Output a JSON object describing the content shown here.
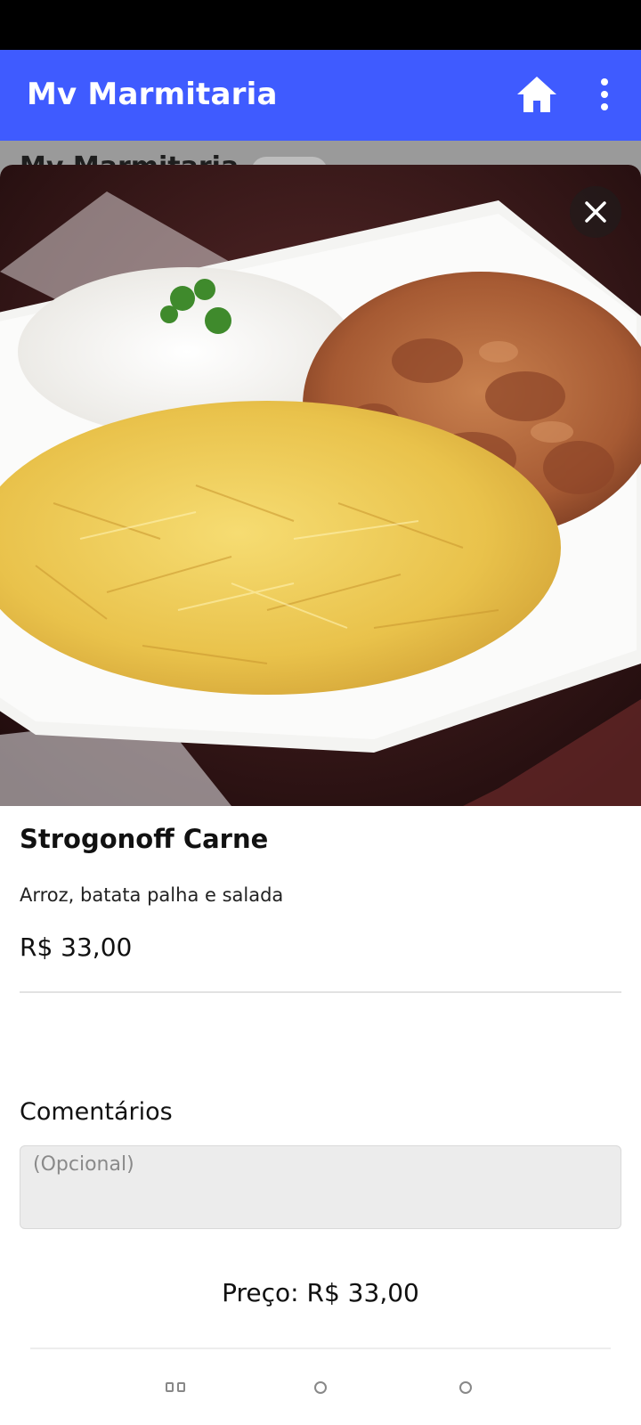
{
  "app_bar": {
    "title": "Mv Marmitaria",
    "color": "#3f5bff",
    "home_icon": "home-icon",
    "menu_icon": "more-vertical-icon"
  },
  "background": {
    "title": "Mv Marmitaria"
  },
  "product": {
    "image": "strogonoff-photo",
    "name": "Strogonoff Carne",
    "description": "Arroz, batata palha e salada",
    "price": "R$ 33,00"
  },
  "comments": {
    "label": "Comentários",
    "placeholder": "(Opcional)",
    "value": ""
  },
  "total": {
    "text": "Preço: R$ 33,00"
  },
  "nav_bar": {
    "recents_icon": "recents-icon",
    "home_icon": "home-circle-icon",
    "back_icon": "back-circle-icon"
  }
}
